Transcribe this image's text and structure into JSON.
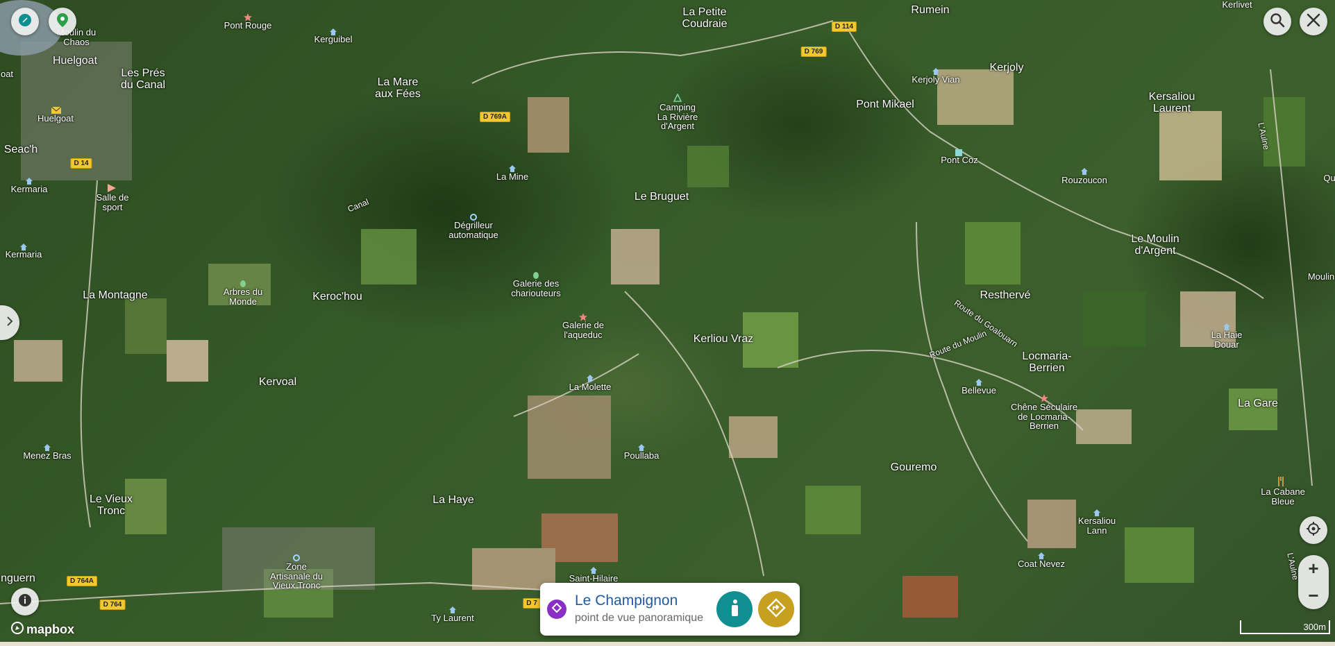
{
  "map": {
    "places": [
      {
        "name": "Pont Rouge",
        "kind": "poi"
      },
      {
        "name": "Kerguibel",
        "kind": "poi"
      },
      {
        "name": "Moulin du\nChaos",
        "kind": "poi"
      },
      {
        "name": "Huelgoat",
        "kind": "town"
      },
      {
        "name": "Les Prés\ndu Canal",
        "kind": "town"
      },
      {
        "name": "La Mare\naux Fées",
        "kind": "town"
      },
      {
        "name": "La Petite\nCoudraie",
        "kind": "town"
      },
      {
        "name": "Rumein",
        "kind": "town"
      },
      {
        "name": "Kerlivet",
        "kind": "poi"
      },
      {
        "name": "Kerjoly",
        "kind": "town"
      },
      {
        "name": "Kerjoly Vian",
        "kind": "poi"
      },
      {
        "name": "Kersaliou\nLaurent",
        "kind": "town"
      },
      {
        "name": "Pont Mikael",
        "kind": "town"
      },
      {
        "name": "Camping\nLa Rivière\nd'Argent",
        "kind": "poi"
      },
      {
        "name": "Huelgoat",
        "kind": "poi"
      },
      {
        "name": "Seac'h",
        "kind": "town"
      },
      {
        "name": "Kermaria",
        "kind": "poi"
      },
      {
        "name": "Salle de\nsport",
        "kind": "poi"
      },
      {
        "name": "Kermaria",
        "kind": "poi"
      },
      {
        "name": "La Mine",
        "kind": "poi"
      },
      {
        "name": "Le Bruguet",
        "kind": "town"
      },
      {
        "name": "Pont Coz",
        "kind": "poi"
      },
      {
        "name": "Rouzoucon",
        "kind": "poi"
      },
      {
        "name": "Dégrilleur\nautomatique",
        "kind": "poi"
      },
      {
        "name": "Le Moulin\nd'Argent",
        "kind": "town"
      },
      {
        "name": "La Montagne",
        "kind": "town"
      },
      {
        "name": "Arbres du\nMonde",
        "kind": "poi"
      },
      {
        "name": "Keroc'hou",
        "kind": "town"
      },
      {
        "name": "Galerie des\nchariouteurs",
        "kind": "poi"
      },
      {
        "name": "Galerie de\nl'aqueduc",
        "kind": "poi"
      },
      {
        "name": "Resthervé",
        "kind": "town"
      },
      {
        "name": "Kerliou Vraz",
        "kind": "town"
      },
      {
        "name": "Locmaria-\nBerrien",
        "kind": "town"
      },
      {
        "name": "La Haie\nDouar",
        "kind": "poi"
      },
      {
        "name": "Moulin",
        "kind": "poi"
      },
      {
        "name": "Kervoal",
        "kind": "town"
      },
      {
        "name": "La Molette",
        "kind": "poi"
      },
      {
        "name": "Bellevue",
        "kind": "poi"
      },
      {
        "name": "Chêne Séculaire\nde Locmaria-\nBerrien",
        "kind": "poi"
      },
      {
        "name": "La Gare",
        "kind": "town"
      },
      {
        "name": "Menez Bras",
        "kind": "poi"
      },
      {
        "name": "Poullaba",
        "kind": "poi"
      },
      {
        "name": "Gouremo",
        "kind": "town"
      },
      {
        "name": "La Cabane\nBleue",
        "kind": "poi"
      },
      {
        "name": "Le Vieux\nTronc",
        "kind": "town"
      },
      {
        "name": "La Haye",
        "kind": "town"
      },
      {
        "name": "Kersaliou\nLann",
        "kind": "poi"
      },
      {
        "name": "Zone\nArtisanale du\nVieux Tronc",
        "kind": "poi"
      },
      {
        "name": "Saint-Hilaire",
        "kind": "poi"
      },
      {
        "name": "Coat Nevez",
        "kind": "poi"
      },
      {
        "name": "Ty Laurent",
        "kind": "poi"
      },
      {
        "name": "nguern",
        "kind": "town"
      },
      {
        "name": "Canal",
        "kind": "road"
      },
      {
        "name": "Route du Moulin",
        "kind": "road"
      },
      {
        "name": "Route du Goalouarn",
        "kind": "road"
      },
      {
        "name": "L'Aulne",
        "kind": "road"
      },
      {
        "name": "L'Aulne",
        "kind": "road"
      },
      {
        "name": "Qu",
        "kind": "poi"
      },
      {
        "name": "oat",
        "kind": "poi"
      }
    ],
    "road_shields": [
      "D 114",
      "D 769",
      "D 769A",
      "D 14",
      "D 764A",
      "D 764",
      "D 7"
    ]
  },
  "controls": {
    "compass_icon": "compass-icon",
    "location_pin_icon": "map-pin-icon",
    "search_icon": "search-icon",
    "close_icon": "close-icon",
    "sidebar_toggle_icon": "chevron-right-icon",
    "info_icon": "info-icon",
    "geolocate_icon": "crosshair-icon",
    "zoom_in": "+",
    "zoom_out": "−"
  },
  "place_card": {
    "title": "Le Champignon",
    "subtitle": "point de vue panoramique",
    "info_icon": "info-icon",
    "directions_icon": "directions-icon",
    "accent_badge": "#8a2fc6",
    "accent_info": "#0f8f8f",
    "accent_directions": "#c8a020"
  },
  "attribution": {
    "logo_text": "mapbox"
  },
  "scale_label": "300m"
}
